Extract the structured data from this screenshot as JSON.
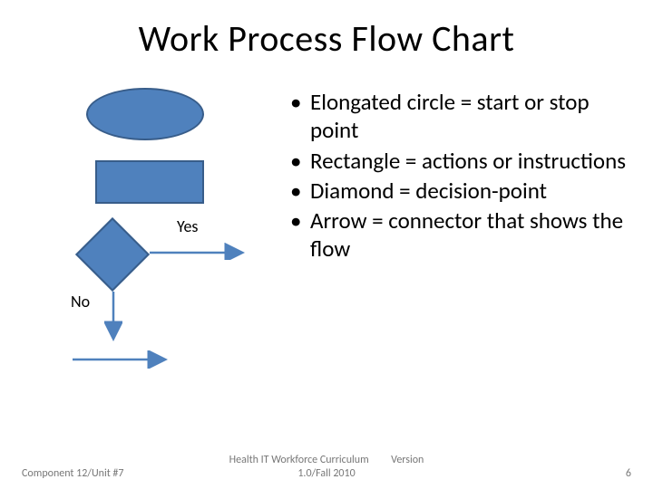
{
  "title": "Work Process Flow Chart",
  "labels": {
    "yes": "Yes",
    "no": "No"
  },
  "bullets": [
    "Elongated circle = start or stop point",
    "Rectangle = actions or instructions",
    "Diamond = decision-point",
    "Arrow = connector that shows the flow"
  ],
  "footer": {
    "left": "Component 12/Unit #7",
    "center_line1": "Health IT Workforce Curriculum",
    "center_line2": "1.0/Fall 2010",
    "version_label": "Version",
    "page_number": "6"
  },
  "shape_color": "#4f81bd",
  "shape_border": "#385d8a"
}
